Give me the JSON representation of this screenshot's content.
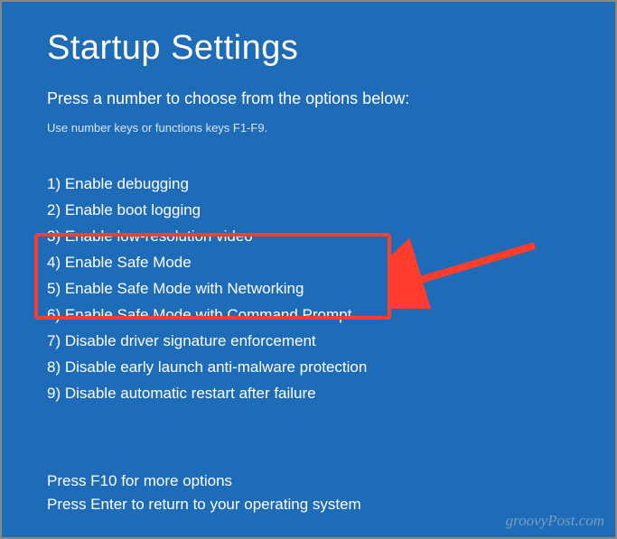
{
  "title": "Startup Settings",
  "subtitle": "Press a number to choose from the options below:",
  "hint": "Use number keys or functions keys F1-F9.",
  "options": [
    "1) Enable debugging",
    "2) Enable boot logging",
    "3) Enable low-resolution video",
    "4) Enable Safe Mode",
    "5) Enable Safe Mode with Networking",
    "6) Enable Safe Mode with Command Prompt",
    "7) Disable driver signature enforcement",
    "8) Disable early launch anti-malware protection",
    "9) Disable automatic restart after failure"
  ],
  "footer": {
    "more": "Press F10 for more options",
    "return": "Press Enter to return to your operating system"
  },
  "watermark": "groovyPost.com"
}
